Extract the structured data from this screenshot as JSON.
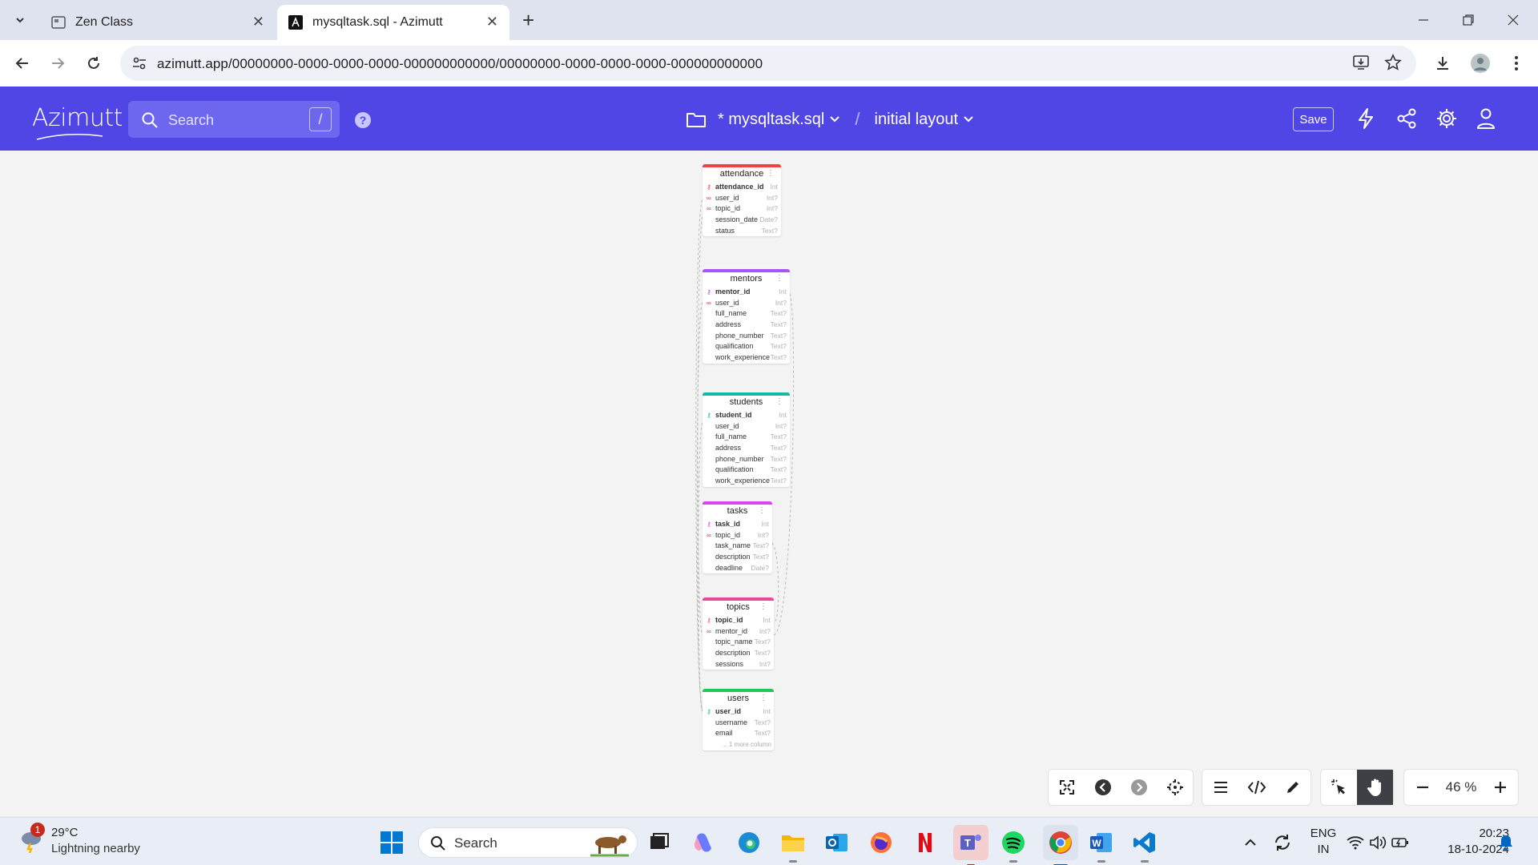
{
  "browser": {
    "tabs": [
      {
        "title": "Zen Class",
        "favicon": "zen-class-icon"
      },
      {
        "title": "mysqltask.sql - Azimutt",
        "favicon": "azimutt-icon"
      }
    ],
    "url": "azimutt.app/00000000-0000-0000-0000-000000000000/00000000-0000-0000-0000-000000000000"
  },
  "app": {
    "logo": "Azimutt",
    "search_placeholder": "Search",
    "search_shortcut": "/",
    "project_name": "* mysqltask.sql",
    "layout_name": "initial layout",
    "save_label": "Save",
    "accent_color": "#4f46e5"
  },
  "erd": {
    "tables": [
      {
        "name": "attendance",
        "color": "#ef4444",
        "columns": [
          {
            "name": "attendance_id",
            "type": "Int",
            "key": "pk"
          },
          {
            "name": "user_id",
            "type": "Int?",
            "key": "fk"
          },
          {
            "name": "topic_id",
            "type": "Int?",
            "key": "fk"
          },
          {
            "name": "session_date",
            "type": "Date?",
            "key": ""
          },
          {
            "name": "status",
            "type": "Text?",
            "key": ""
          }
        ]
      },
      {
        "name": "mentors",
        "color": "#a855f7",
        "columns": [
          {
            "name": "mentor_id",
            "type": "Int",
            "key": "pk"
          },
          {
            "name": "user_id",
            "type": "Int?",
            "key": "fk"
          },
          {
            "name": "full_name",
            "type": "Text?",
            "key": ""
          },
          {
            "name": "address",
            "type": "Text?",
            "key": ""
          },
          {
            "name": "phone_number",
            "type": "Text?",
            "key": ""
          },
          {
            "name": "qualification",
            "type": "Text?",
            "key": ""
          },
          {
            "name": "work_experience",
            "type": "Text?",
            "key": ""
          }
        ]
      },
      {
        "name": "students",
        "color": "#14b8a6",
        "columns": [
          {
            "name": "student_id",
            "type": "Int",
            "key": "pk"
          },
          {
            "name": "user_id",
            "type": "Int?",
            "key": ""
          },
          {
            "name": "full_name",
            "type": "Text?",
            "key": ""
          },
          {
            "name": "address",
            "type": "Text?",
            "key": ""
          },
          {
            "name": "phone_number",
            "type": "Text?",
            "key": ""
          },
          {
            "name": "qualification",
            "type": "Text?",
            "key": ""
          },
          {
            "name": "work_experience",
            "type": "Text?",
            "key": ""
          }
        ]
      },
      {
        "name": "tasks",
        "color": "#d946ef",
        "columns": [
          {
            "name": "task_id",
            "type": "Int",
            "key": "pk"
          },
          {
            "name": "topic_id",
            "type": "Int?",
            "key": "fk"
          },
          {
            "name": "task_name",
            "type": "Text?",
            "key": ""
          },
          {
            "name": "description",
            "type": "Text?",
            "key": ""
          },
          {
            "name": "deadline",
            "type": "Date?",
            "key": ""
          }
        ]
      },
      {
        "name": "topics",
        "color": "#ec4899",
        "columns": [
          {
            "name": "topic_id",
            "type": "Int",
            "key": "pk"
          },
          {
            "name": "mentor_id",
            "type": "Int?",
            "key": "fk"
          },
          {
            "name": "topic_name",
            "type": "Text?",
            "key": ""
          },
          {
            "name": "description",
            "type": "Text?",
            "key": ""
          },
          {
            "name": "sessions",
            "type": "Int?",
            "key": ""
          }
        ]
      },
      {
        "name": "users",
        "color": "#22c55e",
        "columns": [
          {
            "name": "user_id",
            "type": "Int",
            "key": "pk"
          },
          {
            "name": "username",
            "type": "Text?",
            "key": ""
          },
          {
            "name": "email",
            "type": "Text?",
            "key": ""
          }
        ],
        "more": "... 1 more column"
      }
    ]
  },
  "controls": {
    "zoom": "46 %"
  },
  "taskbar": {
    "weather_temp": "29°C",
    "weather_desc": "Lightning nearby",
    "notification_count": "1",
    "search_label": "Search",
    "lang_line1": "ENG",
    "lang_line2": "IN",
    "time": "20:23",
    "date": "18-10-2024"
  }
}
